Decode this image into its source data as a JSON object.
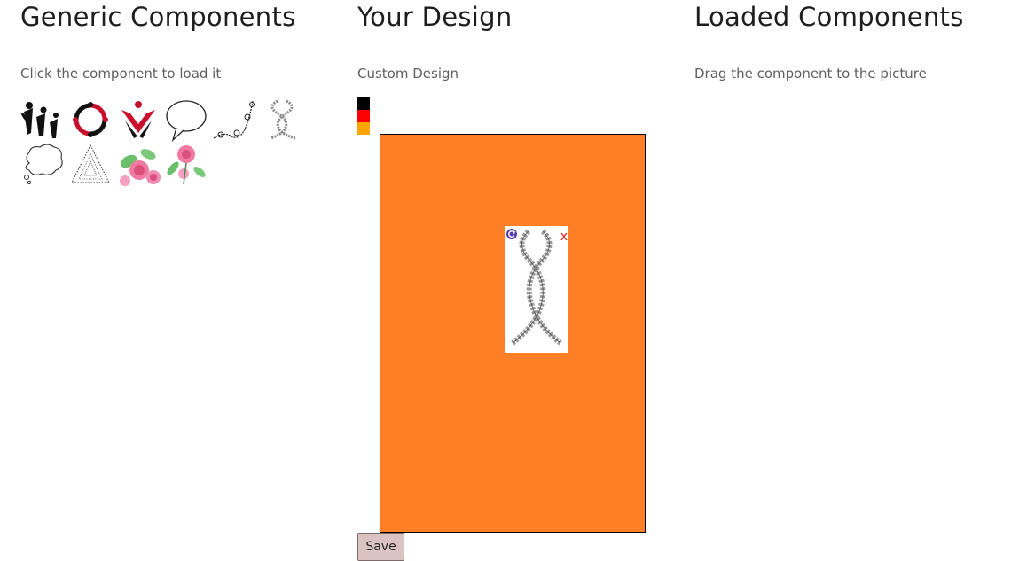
{
  "generic": {
    "title": "Generic Components",
    "subtitle": "Click the component to load it",
    "items": [
      {
        "icon": "people-figures-icon"
      },
      {
        "icon": "circle-figures-icon"
      },
      {
        "icon": "red-figure-icon"
      },
      {
        "icon": "speech-bubble-icon"
      },
      {
        "icon": "ornament-corner-icon"
      },
      {
        "icon": "rope-icon"
      },
      {
        "icon": "thought-cloud-icon"
      },
      {
        "icon": "lace-triangle-icon"
      },
      {
        "icon": "rose-bouquet-icon"
      },
      {
        "icon": "rose-branch-icon"
      }
    ]
  },
  "design": {
    "title": "Your Design",
    "subtitle": "Custom Design",
    "swatches": [
      "#000000",
      "#ff0000",
      "#ffa500"
    ],
    "canvas_color": "#ff7f27",
    "placed_component": {
      "icon": "rope-icon",
      "remove_label": "x",
      "rotate_icon": "rotate-icon"
    },
    "save_label": "Save"
  },
  "loaded": {
    "title": "Loaded Components",
    "subtitle": "Drag the component to the picture"
  }
}
